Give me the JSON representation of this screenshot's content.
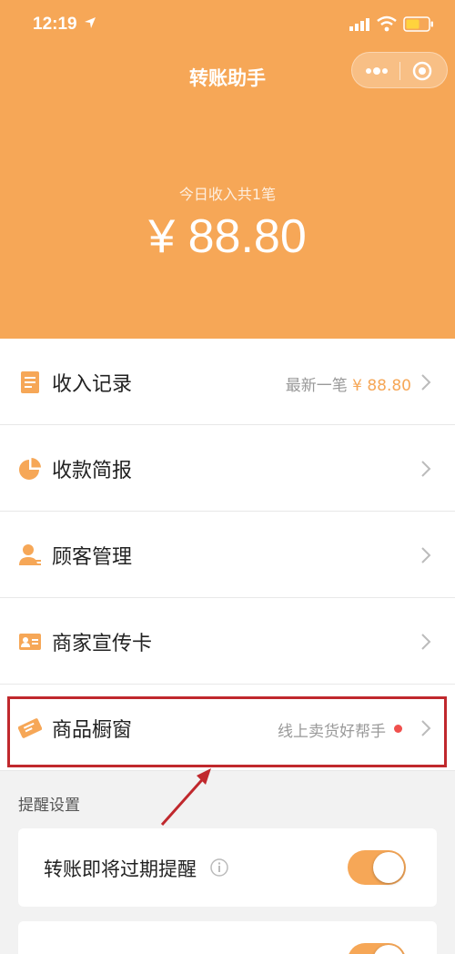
{
  "status": {
    "time": "12:19"
  },
  "header": {
    "title": "转账助手",
    "income_label": "今日收入共1笔",
    "income_amount": "¥ 88.80"
  },
  "menu": [
    {
      "label": "收入记录",
      "right_text": "最新一笔",
      "right_amount": "¥ 88.80",
      "icon": "document-icon"
    },
    {
      "label": "收款简报",
      "icon": "pie-chart-icon"
    },
    {
      "label": "顾客管理",
      "icon": "customer-icon"
    },
    {
      "label": "商家宣传卡",
      "icon": "id-card-icon"
    },
    {
      "label": "商品橱窗",
      "right_text": "线上卖货好帮手",
      "icon": "ticket-icon",
      "has_dot": true
    }
  ],
  "reminder": {
    "section_title": "提醒设置",
    "items": [
      {
        "label": "转账即将过期提醒",
        "enabled": true
      },
      {
        "enabled": true
      }
    ]
  },
  "colors": {
    "accent": "#f6a757",
    "highlight": "#c0282d",
    "dot": "#f0504d"
  }
}
